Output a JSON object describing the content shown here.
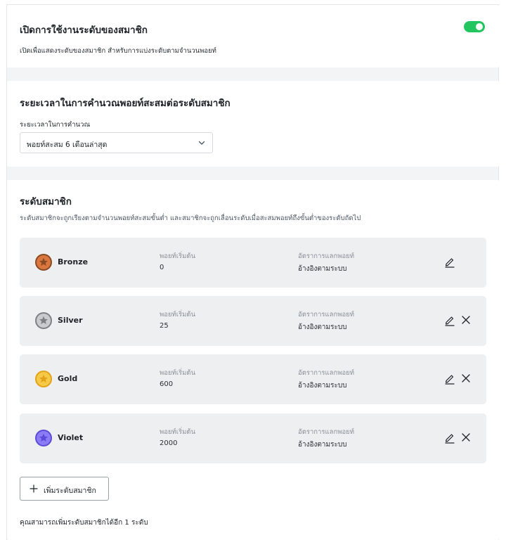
{
  "membership_toggle": {
    "title": "เปิดการใช้งานระดับของสมาชิก",
    "description": "เปิดเพื่อแสดงระดับของสมาชิก สำหรับการแบ่งระดับตามจำนวนพอยท์",
    "enabled": true,
    "accent_color": "#22c55e"
  },
  "period_section": {
    "title": "ระยะเวลาในการคำนวณพอยท์สะสมต่อระดับสมาชิก",
    "select_label": "ระยะเวลาในการคำนวณ",
    "select_value": "พอยท์สะสม 6 เดือนล่าสุด"
  },
  "tiers_section": {
    "title": "ระดับสมาชิก",
    "description": "ระดับสมาชิกจะถูกเรียงตามจำนวนพอยท์สะสมขั้นต่ำ และสมาชิกจะถูกเลื่อนระดับเมื่อสะสมพอยท์ถึงขั้นต่ำของระดับถัดไป",
    "points_label": "พอยท์เริ่มต้น",
    "rate_label": "อัตราการแลกพอยท์",
    "tiers": [
      {
        "name": "Bronze",
        "start_points": "0",
        "rate": "อ้างอิงตามระบบ",
        "color": "#d9773f",
        "ring": "#8a4a22",
        "icon": "star-icon",
        "deletable": false
      },
      {
        "name": "Silver",
        "start_points": "25",
        "rate": "อ้างอิงตามระบบ",
        "color": "#c9cbcf",
        "ring": "#7d8186",
        "icon": "star-icon",
        "deletable": true
      },
      {
        "name": "Gold",
        "start_points": "600",
        "rate": "อ้างอิงตามระบบ",
        "color": "#f7c948",
        "ring": "#e2a21a",
        "icon": "star-icon",
        "deletable": true
      },
      {
        "name": "Violet",
        "start_points": "2000",
        "rate": "อ้างอิงตามระบบ",
        "color": "#8b7cf6",
        "ring": "#5b4bd6",
        "icon": "star-icon",
        "deletable": true
      }
    ],
    "add_button_label": "เพิ่มระดับสมาชิก",
    "footnote": "คุณสามารถเพิ่มระดับสมาชิกได้อีก 1 ระดับ"
  }
}
